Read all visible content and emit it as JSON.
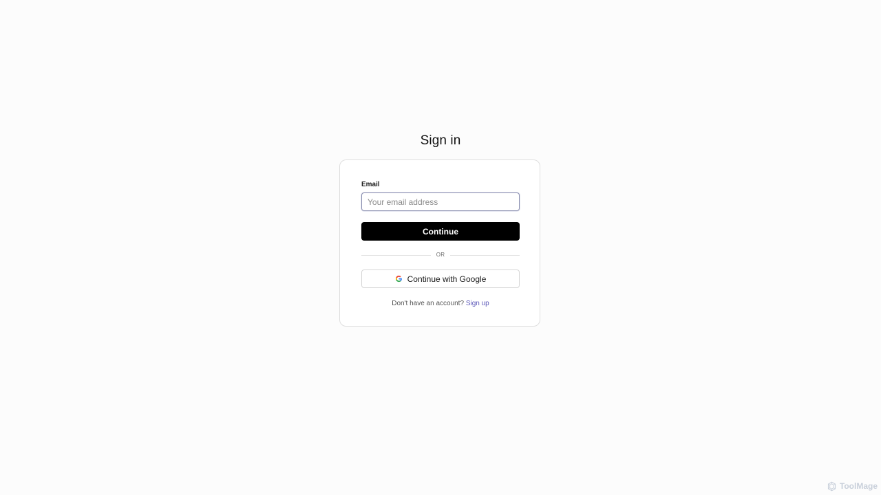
{
  "page": {
    "title": "Sign in"
  },
  "form": {
    "email_label": "Email",
    "email_placeholder": "Your email address",
    "email_value": "",
    "continue_label": "Continue",
    "divider_label": "OR",
    "google_label": "Continue with Google",
    "google_icon": "google-g-icon",
    "signup_prompt": "Don't have an account?",
    "signup_link": "Sign up"
  },
  "watermark": {
    "text": "ToolMage",
    "icon": "toolmage-logo-icon"
  },
  "colors": {
    "background": "#fcfcfc",
    "primary_button": "#000000",
    "link": "#5b57b8",
    "input_border_focus": "#8b8fb0"
  }
}
